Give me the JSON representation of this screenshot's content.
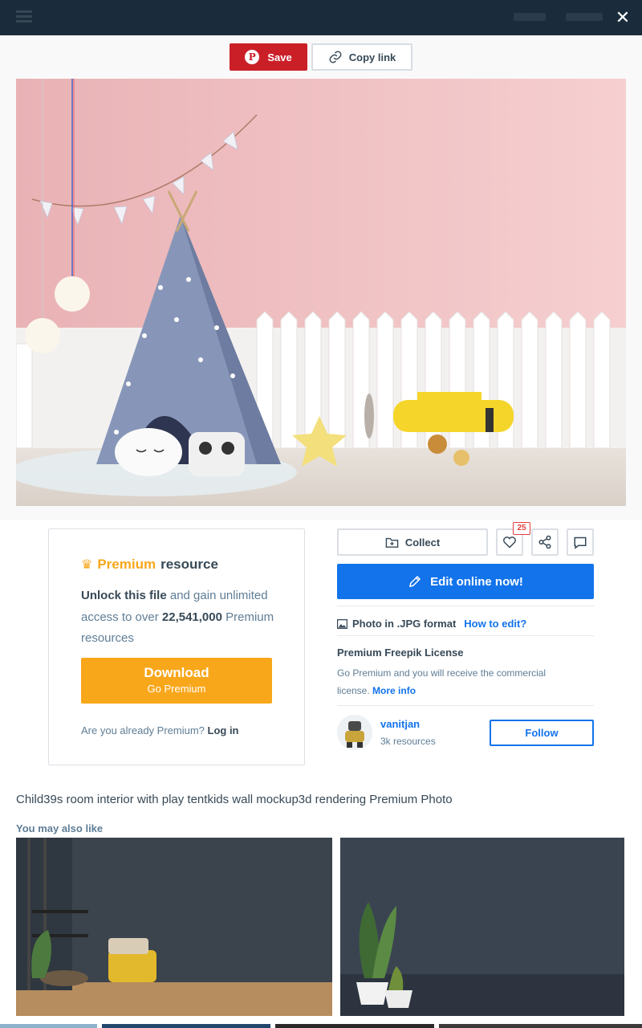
{
  "header": {
    "close_icon": "close-icon",
    "close_glyph": "✕"
  },
  "share_bar": {
    "save_label": "Save",
    "copy_link_label": "Copy link"
  },
  "premium_box": {
    "premium_word": "Premium",
    "resource_word": "resource",
    "unlock_bold": "Unlock this file",
    "unlock_rest": " and gain unlimited access to over ",
    "count_bold": "22,541,000",
    "count_rest": " Premium resources",
    "download_label": "Download",
    "download_sub": "Go Premium",
    "already_text": "Are you already Premium? ",
    "login_label": "Log in"
  },
  "actions": {
    "collect_label": "Collect",
    "like_count": "25",
    "edit_label": "Edit online now!"
  },
  "file_info": {
    "format_text": "Photo in .JPG format",
    "how_to_edit": "How to edit?",
    "license_title": "Premium Freepik License",
    "license_text": "Go Premium and you will receive the commercial license. ",
    "more_info": "More info"
  },
  "author": {
    "name": "vanitjan",
    "resources": "3k resources",
    "follow_label": "Follow"
  },
  "photo_title": "Child39s room interior with play tentkids wall mockup3d rendering Premium Photo",
  "related": {
    "heading": "You may also like"
  },
  "colors": {
    "accent_blue": "#1273eb",
    "premium_orange": "#f8a71b",
    "pinterest_red": "#cb1f27",
    "topbar": "#1a2c3c"
  }
}
